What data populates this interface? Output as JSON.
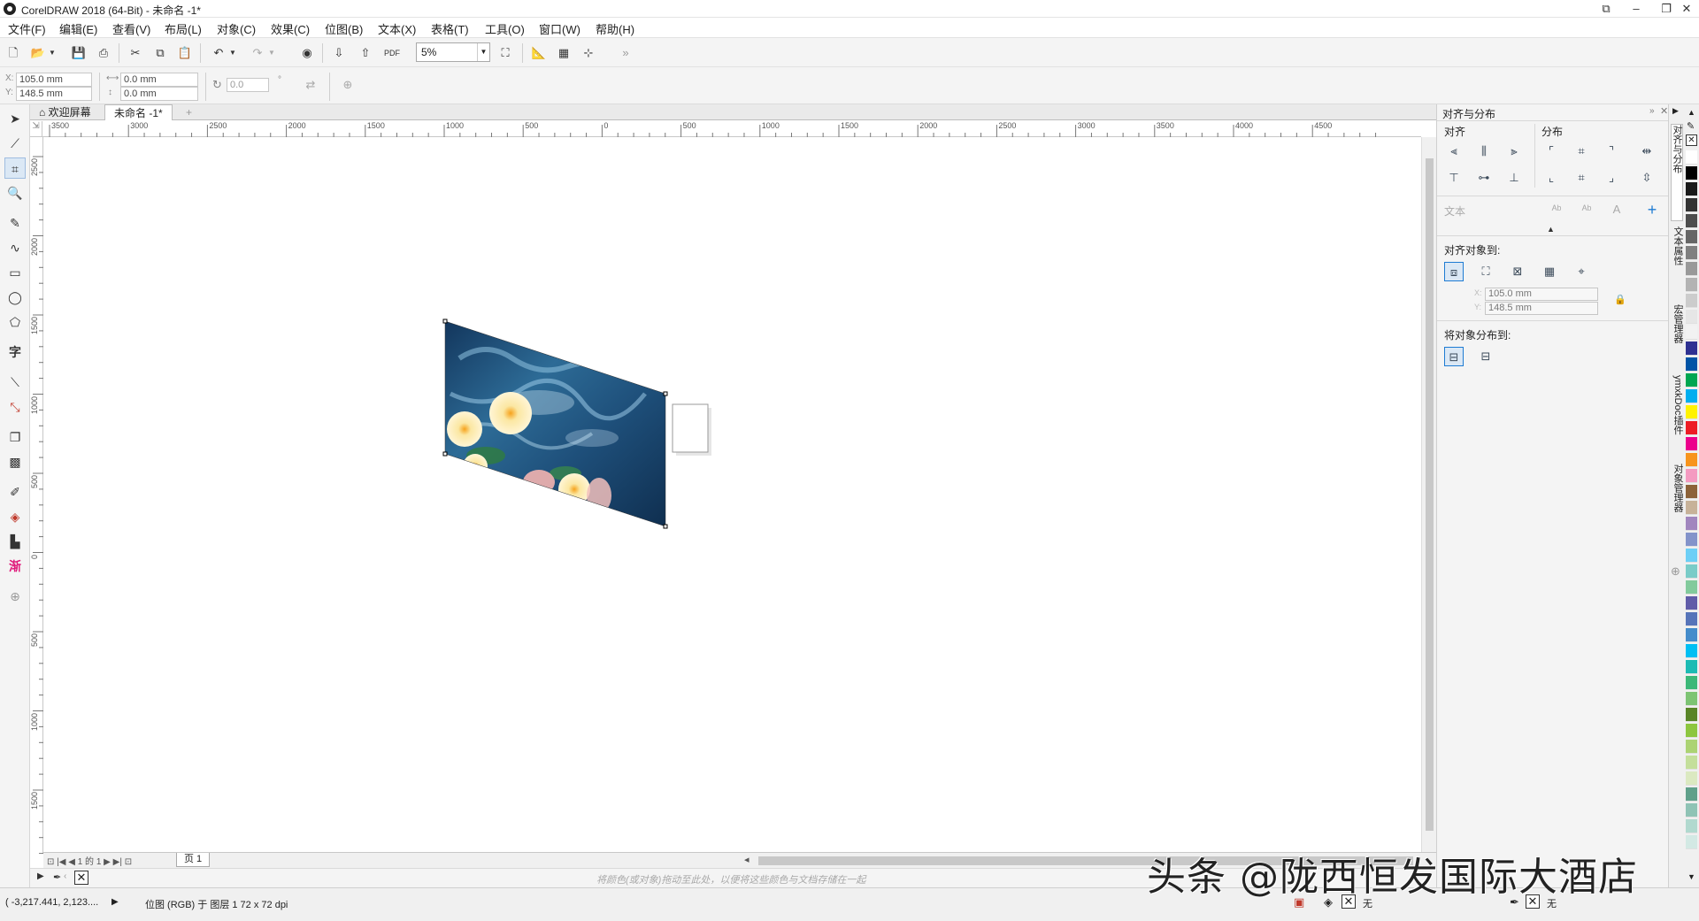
{
  "app": {
    "title": "CorelDRAW 2018 (64-Bit) - 未命名 -1*"
  },
  "window_controls": {
    "restore": "⧉",
    "minimize": "–",
    "maximize": "❐",
    "close": "✕"
  },
  "menu": [
    "文件(F)",
    "编辑(E)",
    "查看(V)",
    "布局(L)",
    "对象(C)",
    "效果(C)",
    "位图(B)",
    "文本(X)",
    "表格(T)",
    "工具(O)",
    "窗口(W)",
    "帮助(H)"
  ],
  "toolbar": {
    "zoom_value": "5%",
    "pdf_label": "PDF",
    "more": "»"
  },
  "property_bar": {
    "x": "105.0 mm",
    "y": "148.5 mm",
    "x_label": "X:",
    "y_label": "Y:",
    "width": "0.0 mm",
    "height": "0.0 mm",
    "rotation": "0.0",
    "degree": "°"
  },
  "doc_tabs": {
    "welcome": "欢迎屏幕",
    "document": "未命名 -1*",
    "add": "+"
  },
  "ruler": {
    "unit_corner": "⇲",
    "h_labels": [
      "3500",
      "3000",
      "2500",
      "2000",
      "1500",
      "1000",
      "500",
      "0",
      "500",
      "1000",
      "1500",
      "2000",
      "2500",
      "3000",
      "3500",
      "4000",
      "4500"
    ],
    "v_labels": [
      "2500",
      "2000",
      "1500",
      "1000",
      "500",
      "0",
      "500",
      "1000",
      "1500",
      "2000"
    ]
  },
  "page_nav": {
    "current": "1",
    "of_label": "的",
    "total": "1",
    "page_tab": "页 1"
  },
  "palette_bar": {
    "hint": "将颜色(或对象)拖动至此处，以便将这些颜色与文档存储在一起"
  },
  "status": {
    "coords": "( -3,217.441, 2,123....",
    "object_info": "位图 (RGB) 于 图层 1 72 x 72 dpi",
    "fill_none": "无",
    "outline_none": "无"
  },
  "docker": {
    "title": "对齐与分布",
    "align_header": "对齐",
    "distribute_header": "分布",
    "text_label": "文本",
    "align_to_label": "对齐对象到:",
    "x_value": "105.0 mm",
    "y_value": "148.5 mm",
    "distribute_to_label": "将对象分布到:"
  },
  "side_tabs": [
    "对齐与分布",
    "文本属性",
    "宏管理器",
    "ymxkDoc插件",
    "对象管理器"
  ],
  "colors": {
    "accent": "#1e7bd3",
    "swatches": [
      "#ffffff",
      "#000000",
      "#1a1a1a",
      "#333333",
      "#4d4d4d",
      "#666666",
      "#808080",
      "#999999",
      "#b3b3b3",
      "#cccccc",
      "#e6e6e6",
      "#f2f2f2",
      "#2e3192",
      "#0054a6",
      "#00a651",
      "#00aeef",
      "#fff200",
      "#ed1c24",
      "#ec008c",
      "#f7941d",
      "#f49ac1",
      "#8c6239",
      "#c7b299",
      "#a186be",
      "#8393ca",
      "#6dcff6",
      "#7accc8",
      "#82ca9c",
      "#605ca8",
      "#5674b9",
      "#448ccb",
      "#00bff3",
      "#1cbbb4",
      "#3cb878",
      "#7dc473",
      "#598527",
      "#8dc63f",
      "#acd373",
      "#c4df9b",
      "#dbe9c1",
      "#5fa08a",
      "#8fc3b5",
      "#b1d9cf",
      "#d3e9e4"
    ]
  },
  "watermark": "头条 @陇西恒发国际大酒店"
}
